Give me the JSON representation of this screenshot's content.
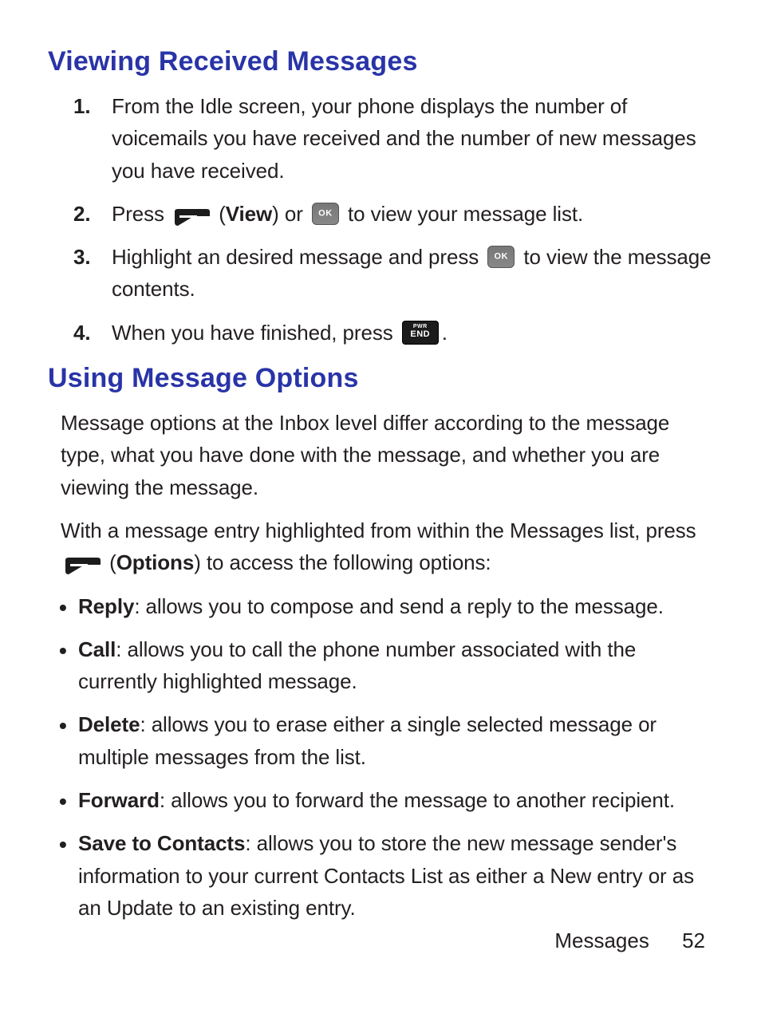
{
  "section1": {
    "title": "Viewing Received Messages",
    "steps": {
      "s1": "From the Idle screen, your phone displays the number of voicemails you have received and the number of new messages you have received.",
      "s2_a": "Press ",
      "s2_view": "View",
      "s2_b": ") or ",
      "s2_c": " to view your message list.",
      "s3_a": "Highlight an desired message and press ",
      "s3_b": " to view the message contents.",
      "s4_a": "When you have finished, press ",
      "s4_b": "."
    }
  },
  "section2": {
    "title": "Using Message Options",
    "intro": "Message options at the Inbox level differ according to the message type, what you have done with the message, and whether you are viewing the message.",
    "lead_a": "With a message entry highlighted from within the Messages list, press ",
    "lead_opt": "Options",
    "lead_b": ") to access the following options:",
    "items": {
      "reply_t": "Reply",
      "reply_d": ": allows you to compose and send a reply to the message.",
      "call_t": "Call",
      "call_d": ": allows you to call the phone number associated with the currently highlighted message.",
      "delete_t": "Delete",
      "delete_d": ": allows you to erase either a single selected message or multiple messages from the list.",
      "forward_t": "Forward",
      "forward_d": ": allows you to forward the message to another recipient.",
      "save_t": "Save to Contacts",
      "save_d": ": allows you to store the new message sender's information to your current Contacts List as either a New entry or as an Update to an existing entry."
    }
  },
  "footer": {
    "section": "Messages",
    "page": "52"
  }
}
